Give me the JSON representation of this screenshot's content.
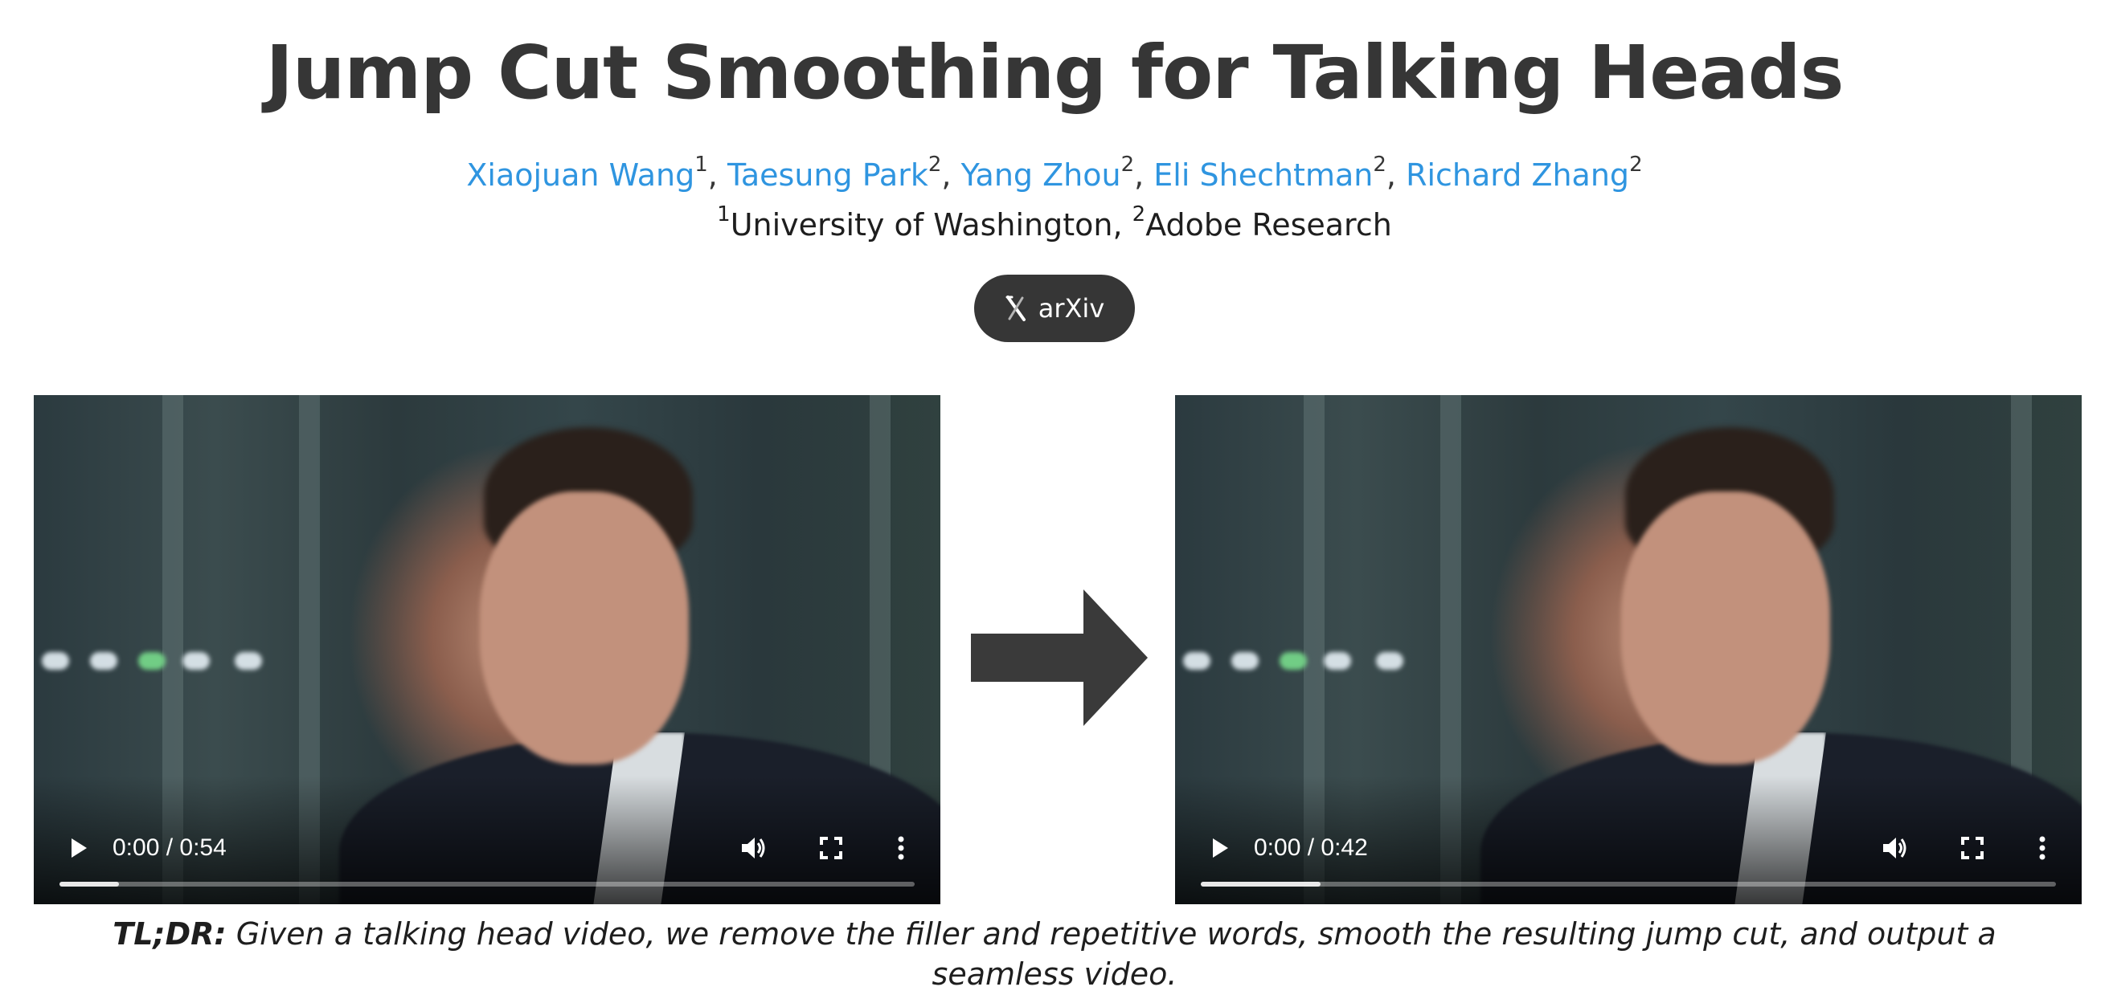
{
  "title": "Jump Cut Smoothing for Talking Heads",
  "authors": [
    {
      "name": "Xiaojuan Wang",
      "aff": "1"
    },
    {
      "name": "Taesung Park",
      "aff": "2"
    },
    {
      "name": "Yang Zhou",
      "aff": "2"
    },
    {
      "name": "Eli Shechtman",
      "aff": "2"
    },
    {
      "name": "Richard Zhang",
      "aff": "2"
    }
  ],
  "separator": ",",
  "affiliations": [
    {
      "num": "1",
      "name": "University of Washington"
    },
    {
      "num": "2",
      "name": "Adobe Research"
    }
  ],
  "links": {
    "arxiv_label": "arXiv",
    "arxiv_icon": "arxiv-icon"
  },
  "videos": {
    "input": {
      "time": "0:00 / 0:54",
      "progress": 0.07,
      "icons": [
        "play-icon",
        "volume-icon",
        "fullscreen-icon",
        "more-vert-icon"
      ]
    },
    "output": {
      "time": "0:00 / 0:42",
      "progress": 0.14,
      "icons": [
        "play-icon",
        "volume-icon",
        "fullscreen-icon",
        "more-vert-icon"
      ]
    }
  },
  "arrow_icon": "arrow-right-icon",
  "tldr": {
    "label": "TL;DR:",
    "text": " Given a talking head video, we remove the filler and repetitive words, smooth the resulting jump cut, and output a seamless video."
  },
  "colors": {
    "title": "#363636",
    "link": "#2f95e0",
    "button_bg": "#363636",
    "arrow": "#3a3a3a"
  }
}
